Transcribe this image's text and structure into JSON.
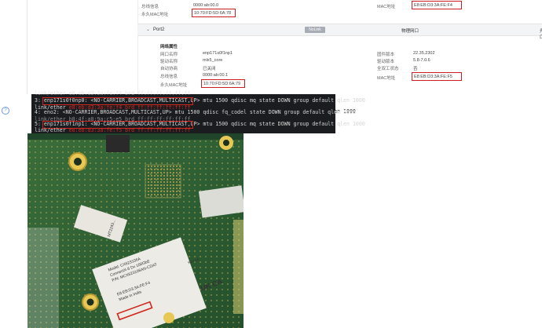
{
  "help_icon": "?",
  "port1": {
    "bus_label": "总线信息",
    "bus_value": "0000:ab:00.0",
    "perm_mac_label": "永久MAC地址",
    "perm_mac_value": "10:70:FD:5D:6A:78",
    "mac_label": "MAC地址",
    "mac_value": "E8:EB:D3:3A:FE:F4"
  },
  "port2_header": {
    "label": "Port2",
    "status": "NoLink",
    "type": "物理网口",
    "mode": "光口"
  },
  "port2_details": {
    "section_title": "网络属性",
    "rows_left": [
      {
        "label": "网口名称",
        "value": "enp171s0f1np1"
      },
      {
        "label": "驱动名称",
        "value": "mlx5_core"
      },
      {
        "label": "自动协商",
        "value": "已关闭"
      },
      {
        "label": "总线信息",
        "value": "0000:ab:00.1"
      },
      {
        "label": "永久MAC地址",
        "value": "10:70:FD:5D:6A:79"
      }
    ],
    "rows_right": [
      {
        "label": "固件版本",
        "value": "22.35.2302"
      },
      {
        "label": "驱动版本",
        "value": "5.8-7.0.6"
      },
      {
        "label": "全双工状态",
        "value": "否"
      },
      {
        "label": "MAC地址",
        "value": "E8:EB:D3:3A:FE:F5"
      }
    ]
  },
  "terminal": {
    "line0": "    link/ether e8:eb:d3:3a:fe:f4 brd ff:ff:ff:ff:ff:ff",
    "line1_prefix": "3: ",
    "line1_iface": "enp171s0f0np0: <NO-CARRIER,BROADCAST,MULTICAST,UP>",
    "line1_rest": " mtu 1500 qdisc mq state DOWN group default qlen 1000",
    "line2_pre": "    link/ether ",
    "line2_mac": "e8:eb:d3:3a:fe:f4",
    "line2_post": " brd ff:ff:ff:ff:ff:ff",
    "line3": "4: eno2: <NO-CARRIER,BROADCAST,MULTICAST,UP> mtu 1500 qdisc fq_codel state DOWN group default qlen 1000",
    "line4": "    link/ether b8:4f:a0:9a:c5:e5 brd ff:ff:ff:ff:ff:ff",
    "line5_prefix": "5: ",
    "line5_iface": "enp171s0f1np1: <NO-CARRIER,BROADCAST,MULTICAST,UP>",
    "line5_rest": " mtu 1500 qdisc mq state DOWN group default qlen 1000",
    "line6_pre": "    link/ether ",
    "line6_mac": "e8:eb:d3:3a:fe:f5",
    "line6_post": " brd ff:ff:ff:ff:ff:ff"
  },
  "photo_labels": {
    "model": "Model: CX623106A",
    "desc": "ConnectX-6 Dx 100GbE",
    "pn": "P/N: MCX623106AN-CDAT",
    "mac_sticker": "E8:EB:D3:3A:FE:F4",
    "made_in": "Made in India",
    "serial": "MT2243...",
    "ukca": "UK CA",
    "rev": "Rev:A6"
  }
}
